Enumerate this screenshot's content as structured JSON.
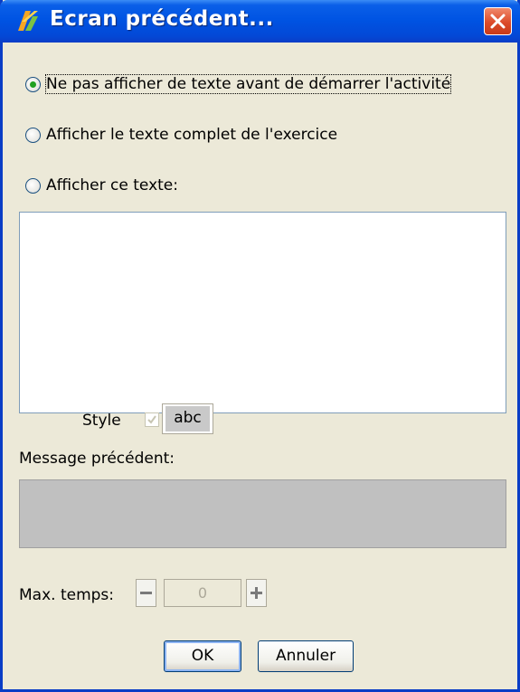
{
  "window": {
    "title": "Ecran précédent..."
  },
  "options": [
    {
      "label": "Ne pas afficher de texte avant de démarrer l'activité",
      "checked": true
    },
    {
      "label": "Afficher le texte complet de l'exercice",
      "checked": false
    },
    {
      "label": "Afficher ce texte:",
      "checked": false
    }
  ],
  "text_area": {
    "value": ""
  },
  "style": {
    "label": "Style",
    "checkbox_checked": true,
    "button_label": "abc"
  },
  "message": {
    "label": "Message précédent:",
    "value": ""
  },
  "max_time": {
    "label": "Max. temps:",
    "value": "0"
  },
  "buttons": {
    "ok": "OK",
    "cancel": "Annuler"
  },
  "colors": {
    "titlebar": "#0054e3",
    "radio_dot": "#21a121",
    "close_button": "#dc4b2a",
    "dialog_bg": "#ece9d8"
  }
}
